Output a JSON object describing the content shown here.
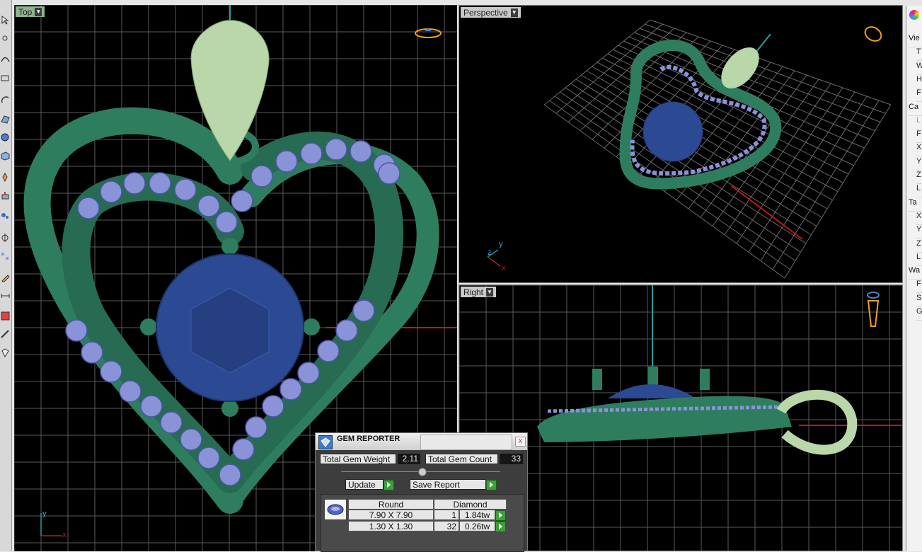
{
  "viewports": {
    "top": {
      "label": "Top"
    },
    "perspective": {
      "label": "Perspective"
    },
    "right": {
      "label": "Right"
    }
  },
  "axes": {
    "x": "x",
    "y": "y",
    "z": "z"
  },
  "properties_panel": {
    "rows": [
      "Vie",
      "T",
      "W",
      "H",
      "F",
      "Ca",
      "L",
      "F",
      "X",
      "Y",
      "Z",
      "L",
      "Ta",
      "X",
      "Y",
      "Z",
      "L",
      "Wa",
      "F",
      "S",
      "G"
    ]
  },
  "gem_reporter": {
    "title": "GEM REPORTER",
    "close": "x",
    "total_weight_label": "Total Gem Weight",
    "total_weight_value": "2.11",
    "total_count_label": "Total Gem Count",
    "total_count_value": "33",
    "update_label": "Update",
    "save_report_label": "Save Report",
    "table": {
      "headers": [
        "Round",
        "Diamond"
      ],
      "rows": [
        {
          "size": "7.90 X 7.90",
          "count": "1",
          "weight": "1.84tw"
        },
        {
          "size": "1.30 X 1.30",
          "count": "32",
          "weight": "0.26tw"
        }
      ]
    }
  },
  "colors": {
    "metal": "#2e7d5f",
    "bail": "#b9d7a8",
    "center_gem": "#2c4a93",
    "side_gems": "#8a93d8",
    "grid": "#5a5a5a",
    "axis_x": "#c01818",
    "axis_y": "#1fa0a0"
  }
}
